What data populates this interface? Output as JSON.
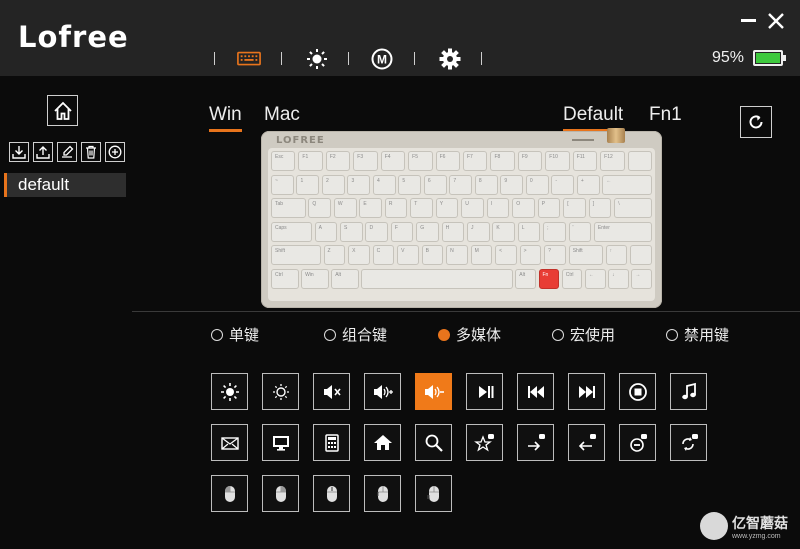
{
  "app": {
    "logo": "Lofree"
  },
  "header": {
    "nav": [
      {
        "name": "keyboard-icon",
        "active": true
      },
      {
        "name": "brightness-icon",
        "active": false
      },
      {
        "name": "macro-icon",
        "label": "M",
        "active": false
      },
      {
        "name": "gear-icon",
        "active": false
      }
    ],
    "battery": {
      "percent_label": "95%",
      "level": 0.95
    }
  },
  "sidebar": {
    "tools": [
      "download-icon",
      "upload-icon",
      "edit-icon",
      "trash-icon",
      "add-icon"
    ],
    "profiles": [
      {
        "label": "default",
        "selected": true
      }
    ]
  },
  "os_tabs": [
    {
      "label": "Win",
      "active": true
    },
    {
      "label": "Mac",
      "active": false
    }
  ],
  "layer_tabs": [
    {
      "label": "Default",
      "active": true
    },
    {
      "label": "Fn1",
      "active": false
    }
  ],
  "keyboard": {
    "brand": "LOFREE",
    "rows": [
      [
        "Esc",
        "F1",
        "F2",
        "F3",
        "F4",
        "F5",
        "F6",
        "F7",
        "F8",
        "F9",
        "F10",
        "F11",
        "F12",
        ""
      ],
      [
        "~",
        "1",
        "2",
        "3",
        "4",
        "5",
        "6",
        "7",
        "8",
        "9",
        "0",
        "-",
        "+",
        "←"
      ],
      [
        "Tab",
        "Q",
        "W",
        "E",
        "R",
        "T",
        "Y",
        "U",
        "I",
        "O",
        "P",
        "[",
        "]",
        "\\"
      ],
      [
        "Caps",
        "A",
        "S",
        "D",
        "F",
        "G",
        "H",
        "J",
        "K",
        "L",
        ";",
        "'",
        "Enter"
      ],
      [
        "Shift",
        "Z",
        "X",
        "C",
        "V",
        "B",
        "N",
        "M",
        "<",
        ">",
        "?",
        "Shift",
        "↑",
        ""
      ],
      [
        "Ctrl",
        "Win",
        "Alt",
        "",
        "Alt",
        "Fn",
        "Ctrl",
        "←",
        "↓",
        "→"
      ]
    ]
  },
  "modes": [
    {
      "label": "单键",
      "selected": false
    },
    {
      "label": "组合键",
      "selected": false
    },
    {
      "label": "多媒体",
      "selected": true
    },
    {
      "label": "宏使用",
      "selected": false
    },
    {
      "label": "禁用键",
      "selected": false
    }
  ],
  "functions": [
    [
      "brightness-up-icon",
      "brightness-down-icon",
      "mute-icon",
      "volume-up-icon",
      "volume-down-icon",
      "play-pause-icon",
      "previous-track-icon",
      "next-track-icon",
      "stop-icon",
      "music-icon"
    ],
    [
      "mail-icon",
      "computer-icon",
      "calculator-icon",
      "home-icon",
      "search-icon",
      "favorites-icon",
      "forward-icon",
      "back-icon",
      "stop-web-icon",
      "refresh-icon"
    ],
    [
      "mouse-left-icon",
      "mouse-right-icon",
      "mouse-middle-icon",
      "mouse-forward-icon",
      "mouse-back-icon"
    ]
  ],
  "functions_active": "volume-down-icon",
  "watermark": {
    "text": "亿智蘑菇",
    "sub": "www.yzmg.com"
  }
}
